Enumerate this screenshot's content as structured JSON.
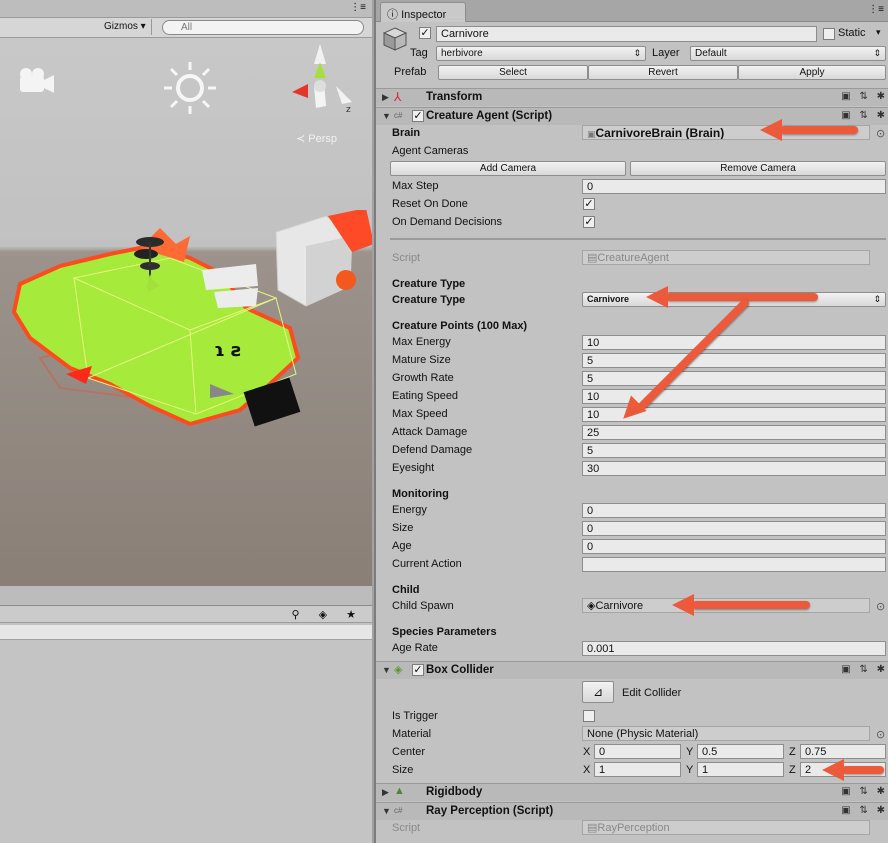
{
  "scene": {
    "gizmos_label": "Gizmos",
    "search_placeholder": "All",
    "persp_label": "Persp"
  },
  "inspector": {
    "tab_label": "Inspector",
    "object_name": "Carnivore",
    "static_label": "Static",
    "tag_label": "Tag",
    "tag_value": "herbivore",
    "layer_label": "Layer",
    "layer_value": "Default",
    "prefab_label": "Prefab",
    "prefab_buttons": [
      "Select",
      "Revert",
      "Apply"
    ],
    "transform": {
      "title": "Transform"
    },
    "creature_agent": {
      "title": "Creature Agent (Script)",
      "brain_label": "Brain",
      "brain_value": "CarnivoreBrain (Brain)",
      "agent_cameras_label": "Agent Cameras",
      "add_camera": "Add Camera",
      "remove_camera": "Remove Camera",
      "max_step_label": "Max Step",
      "max_step_value": "0",
      "reset_on_done_label": "Reset On Done",
      "on_demand_label": "On Demand Decisions",
      "script_label": "Script",
      "script_value": "CreatureAgent",
      "creature_type_header": "Creature Type",
      "creature_type_label": "Creature Type",
      "creature_type_value": "Carnivore",
      "points_header": "Creature Points (100 Max)",
      "points": [
        {
          "label": "Max Energy",
          "value": "10"
        },
        {
          "label": "Mature Size",
          "value": "5"
        },
        {
          "label": "Growth Rate",
          "value": "5"
        },
        {
          "label": "Eating Speed",
          "value": "10"
        },
        {
          "label": "Max Speed",
          "value": "10"
        },
        {
          "label": "Attack Damage",
          "value": "25"
        },
        {
          "label": "Defend Damage",
          "value": "5"
        },
        {
          "label": "Eyesight",
          "value": "30"
        }
      ],
      "monitoring_header": "Monitoring",
      "monitoring": [
        {
          "label": "Energy",
          "value": "0"
        },
        {
          "label": "Size",
          "value": "0"
        },
        {
          "label": "Age",
          "value": "0"
        },
        {
          "label": "Current Action",
          "value": ""
        }
      ],
      "child_header": "Child",
      "child_spawn_label": "Child Spawn",
      "child_spawn_value": "Carnivore",
      "species_header": "Species Parameters",
      "age_rate_label": "Age Rate",
      "age_rate_value": "0.001"
    },
    "box_collider": {
      "title": "Box Collider",
      "edit_collider": "Edit Collider",
      "is_trigger_label": "Is Trigger",
      "material_label": "Material",
      "material_value": "None (Physic Material)",
      "center_label": "Center",
      "center": {
        "x": "0",
        "y": "0.5",
        "z": "0.75"
      },
      "size_label": "Size",
      "size": {
        "x": "1",
        "y": "1",
        "z": "2"
      },
      "axis_labels": [
        "X",
        "Y",
        "Z"
      ]
    },
    "rigidbody": {
      "title": "Rigidbody"
    },
    "ray_perception": {
      "title": "Ray Perception (Script)",
      "script_label": "Script",
      "script_value": "RayPerception"
    }
  },
  "colors": {
    "annotation_arrow": "#ec5a3c",
    "creature_body": "#a6ea3c",
    "creature_outline": "#ff4b1e"
  }
}
